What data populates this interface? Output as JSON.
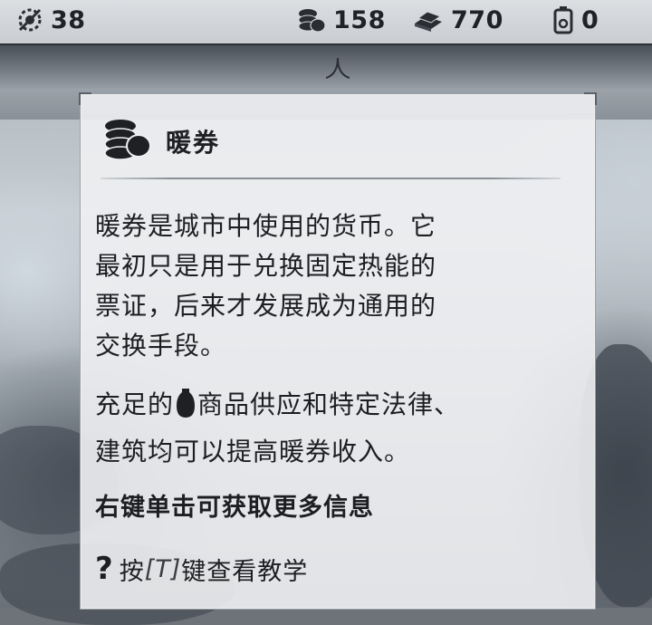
{
  "resources": {
    "workers": {
      "icon": "strike-worker-icon",
      "value": "38"
    },
    "heatstamps": {
      "icon": "heatstamps-coins-icon",
      "value": "158"
    },
    "materials": {
      "icon": "material-bars-icon",
      "value": "770"
    },
    "fuel": {
      "icon": "canister-icon",
      "value": "0"
    }
  },
  "tooltip": {
    "icon": "heatstamps-coins-icon",
    "title": "暖券",
    "description_lines": [
      "暖券是城市中使用的货币。它",
      "最初只是用于兑换固定热能的",
      "票证，后来才发展成为通用的",
      "交换手段。"
    ],
    "supply_prefix": "充足的",
    "supply_icon": "goods-vase-icon",
    "supply_suffix": "商品供应和特定法律、",
    "supply_line2": "建筑均可以提高暖券收入。",
    "right_click_hint": "右键单击可获取更多信息",
    "tutorial": {
      "icon": "question-icon",
      "press": "按",
      "key": "[T]",
      "rest": "键查看教学"
    }
  }
}
